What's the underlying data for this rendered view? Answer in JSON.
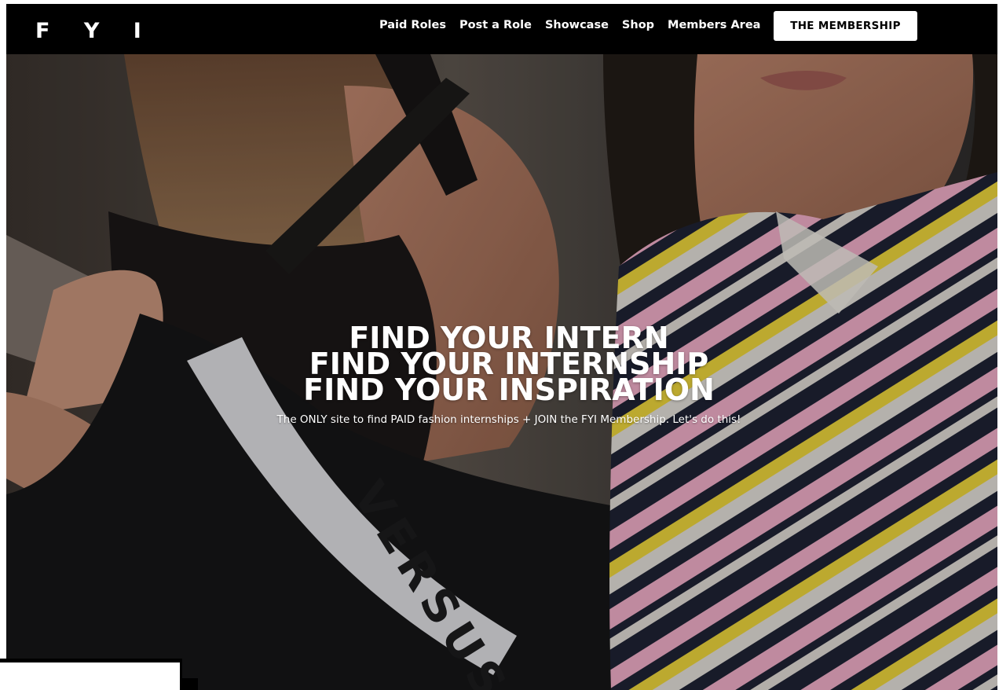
{
  "header": {
    "logo": "F Y I",
    "nav": [
      {
        "label": "Paid Roles"
      },
      {
        "label": "Post a Role"
      },
      {
        "label": "Showcase"
      },
      {
        "label": "Shop"
      },
      {
        "label": "Members Area"
      }
    ],
    "cta_label": "THE MEMBERSHIP"
  },
  "hero": {
    "headline_lines": [
      "FIND YOUR INTERN",
      "FIND YOUR INTERNSHIP",
      "FIND YOUR INSPIRATION"
    ],
    "subtitle": "The ONLY site to find PAID fashion internships + JOIN the FYI Membership. Let's do this!",
    "image_text": "VERSUS"
  },
  "colors": {
    "header_bg": "#000000",
    "cta_bg": "#ffffff",
    "text": "#ffffff",
    "stripe_pink": "#e9a9c2",
    "stripe_yellow": "#e6cf3a",
    "stripe_navy": "#1e2233"
  }
}
